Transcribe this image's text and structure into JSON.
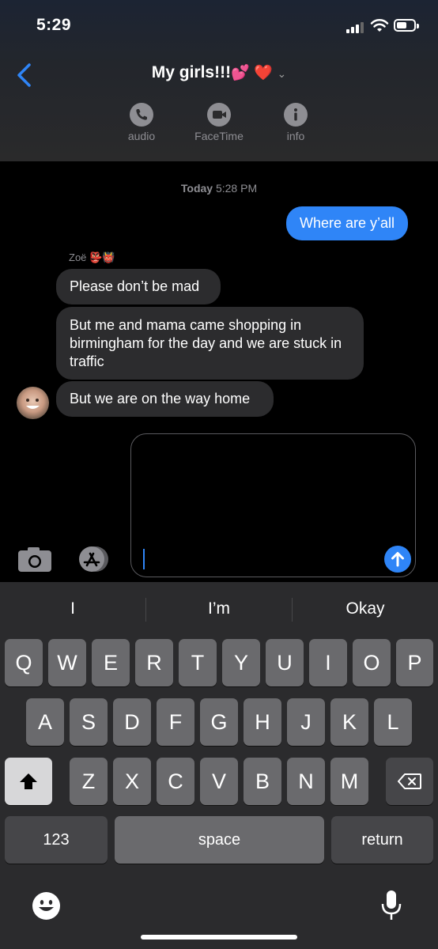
{
  "status": {
    "time": "5:29"
  },
  "header": {
    "title": "My girls!!!",
    "title_emoji": "💕 ❤️",
    "chevron": "⌄",
    "actions": [
      {
        "label": "audio",
        "icon": "phone-icon"
      },
      {
        "label": "FaceTime",
        "icon": "video-icon"
      },
      {
        "label": "info",
        "icon": "info-icon"
      }
    ]
  },
  "thread": {
    "day": "Today",
    "time": "5:28 PM",
    "outgoing": [
      {
        "text": "Where are y’all"
      }
    ],
    "sender_name": "Zoë",
    "sender_emoji": "👺👹",
    "incoming": [
      {
        "text": "Please don’t be mad"
      },
      {
        "text": "But me and mama came shopping in birmingham for the day and we are stuck in traffic"
      },
      {
        "text": "But we are on the way home"
      }
    ]
  },
  "composer": {
    "value": ""
  },
  "keyboard": {
    "suggestions": [
      "I",
      "I’m",
      "Okay"
    ],
    "row1": [
      "Q",
      "W",
      "E",
      "R",
      "T",
      "Y",
      "U",
      "I",
      "O",
      "P"
    ],
    "row2": [
      "A",
      "S",
      "D",
      "F",
      "G",
      "H",
      "J",
      "K",
      "L"
    ],
    "row3": [
      "Z",
      "X",
      "C",
      "V",
      "B",
      "N",
      "M"
    ],
    "numbers": "123",
    "space": "space",
    "return": "return"
  },
  "colors": {
    "accent": "#2f85f7",
    "incoming_bubble": "#2c2c2e",
    "keyboard_bg": "#2b2b2d"
  }
}
